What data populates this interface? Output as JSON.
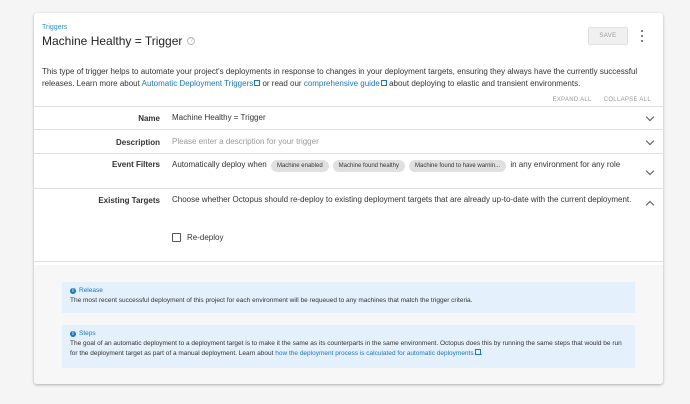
{
  "breadcrumb": "Triggers",
  "title": "Machine Healthy = Trigger",
  "save_label": "SAVE",
  "description": {
    "part1": "This type of trigger helps to automate your project's deployments in response to changes in your deployment targets, ensuring they always have the currently successful releases. Learn more about ",
    "link1": "Automatic Deployment Triggers",
    "part2": " or read our ",
    "link2": "comprehensive guide",
    "part3": " about deploying to elastic and transient environments."
  },
  "expand_all": "EXPAND ALL",
  "collapse_all": "COLLAPSE ALL",
  "rows": {
    "name": {
      "label": "Name",
      "value": "Machine Healthy = Trigger"
    },
    "description": {
      "label": "Description",
      "placeholder": "Please enter a description for your trigger"
    },
    "event_filters": {
      "label": "Event Filters",
      "prefix": "Automatically deploy when",
      "chips": [
        "Machine enabled",
        "Machine found healthy",
        "Machine found to have warnin..."
      ],
      "suffix": "in any environment for any role"
    },
    "existing_targets": {
      "label": "Existing Targets",
      "text": "Choose whether Octopus should re-deploy to existing deployment targets that are already up-to-date with the current deployment.",
      "checkbox_label": "Re-deploy",
      "checked": false
    }
  },
  "release_info": {
    "title": "Release",
    "text": "The most recent successful deployment of this project for each environment will be requeued to any machines that match the trigger criteria."
  },
  "steps_info": {
    "title": "Steps",
    "text": "The goal of an automatic deployment to a deployment target is to make it the same as its counterparts in the same environment. Octopus does this by running the same steps that would be run for the deployment target as part of a manual deployment. Learn about ",
    "link": "how the deployment process is calculated for automatic deployments"
  }
}
